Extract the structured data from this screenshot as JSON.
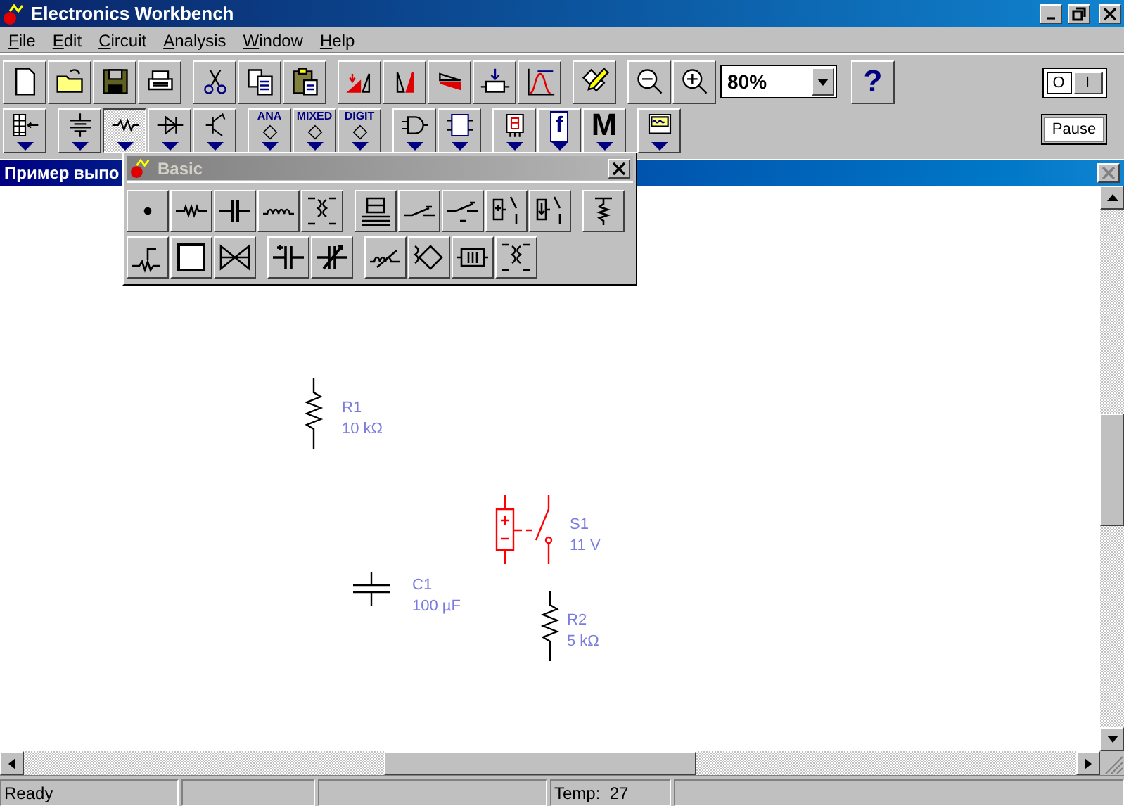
{
  "window": {
    "title": "Electronics Workbench"
  },
  "menu": [
    "File",
    "Edit",
    "Circuit",
    "Analysis",
    "Window",
    "Help"
  ],
  "zoom": {
    "value": "80%"
  },
  "help_button": {
    "label": "?"
  },
  "parts_bins": [
    {
      "selected": false
    },
    {
      "selected": false
    },
    {
      "selected": true
    },
    {
      "selected": false
    },
    {
      "selected": false
    },
    {
      "selected": false,
      "label": "ANA"
    },
    {
      "selected": false,
      "label": "MIXED"
    },
    {
      "selected": false,
      "label": "DIGIT"
    },
    {
      "selected": false
    },
    {
      "selected": false
    },
    {
      "selected": false
    },
    {
      "selected": false,
      "label": "f"
    },
    {
      "selected": false,
      "label": "M"
    },
    {
      "selected": false
    }
  ],
  "power_switch": {
    "off_label": "O",
    "on_label": "I",
    "on": true
  },
  "pause_button": {
    "label": "Pause"
  },
  "circuit_window": {
    "title": "Пример выпо"
  },
  "basic_palette": {
    "title": "Basic"
  },
  "components": [
    {
      "kind": "resistor",
      "name": "R1",
      "value": "10 kΩ",
      "selected": false
    },
    {
      "kind": "relay",
      "name": "S1",
      "value": "11 V",
      "selected": true
    },
    {
      "kind": "capacitor",
      "name": "C1",
      "value": "100 µF",
      "selected": false
    },
    {
      "kind": "resistor",
      "name": "R2",
      "value": "5 kΩ",
      "selected": false
    }
  ],
  "status_bar": {
    "message": "Ready",
    "temperature": "Temp:  27"
  }
}
